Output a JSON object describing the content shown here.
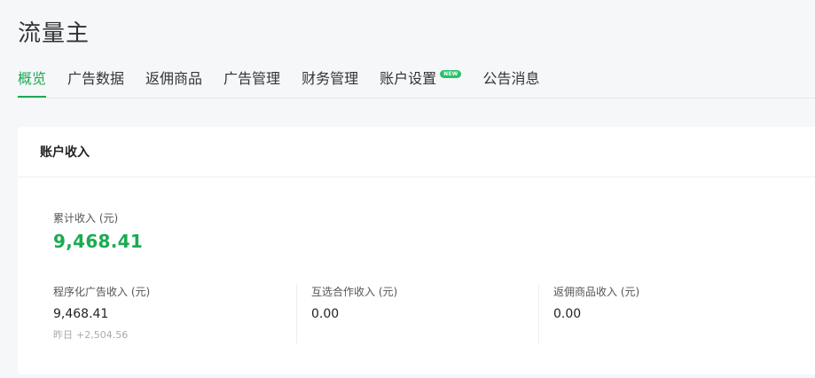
{
  "page_title": "流量主",
  "tabs": [
    {
      "label": "概览",
      "active": true
    },
    {
      "label": "广告数据",
      "active": false
    },
    {
      "label": "返佣商品",
      "active": false
    },
    {
      "label": "广告管理",
      "active": false
    },
    {
      "label": "财务管理",
      "active": false
    },
    {
      "label": "账户设置",
      "active": false,
      "badge": "NEW"
    },
    {
      "label": "公告消息",
      "active": false
    }
  ],
  "income_card": {
    "title": "账户收入",
    "total_label": "累计收入 (元)",
    "total_value": "9,468.41",
    "stats": [
      {
        "label": "程序化广告收入 (元)",
        "value": "9,468.41",
        "sub_label": "昨日",
        "sub_value": "+2,504.56"
      },
      {
        "label": "互选合作收入 (元)",
        "value": "0.00"
      },
      {
        "label": "返佣商品收入 (元)",
        "value": "0.00"
      }
    ]
  },
  "colors": {
    "accent": "#1aab52",
    "badge": "#27c268",
    "background": "#f6f7f9"
  }
}
